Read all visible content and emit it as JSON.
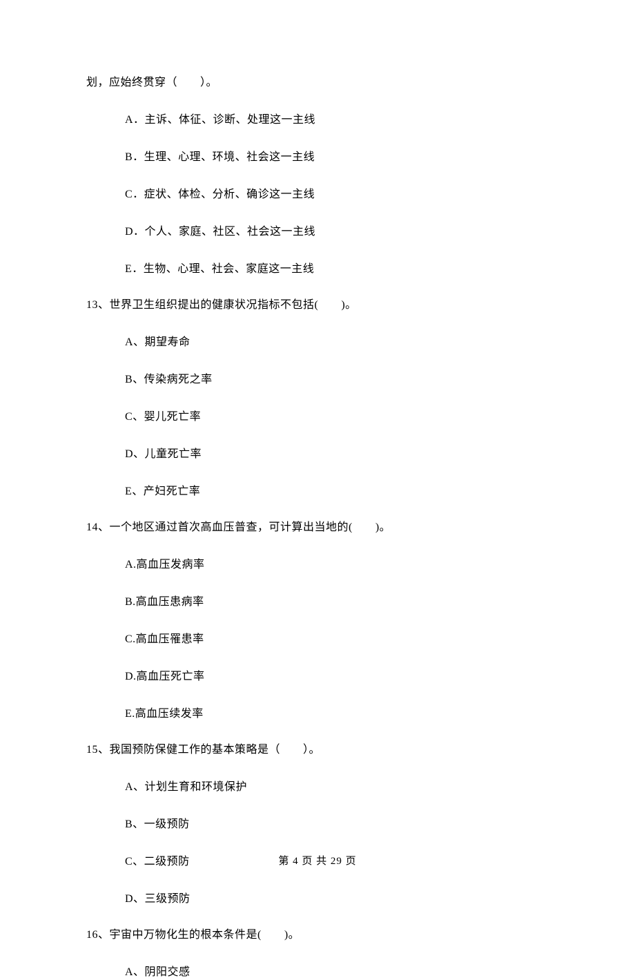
{
  "continuation": "划，应始终贯穿（　　）。",
  "q12": {
    "A": "A．主诉、体征、诊断、处理这一主线",
    "B": "B．生理、心理、环境、社会这一主线",
    "C": "C．症状、体检、分析、确诊这一主线",
    "D": "D．个人、家庭、社区、社会这一主线",
    "E": "E．生物、心理、社会、家庭这一主线"
  },
  "q13": {
    "stem": "13、世界卫生组织提出的健康状况指标不包括(　　)。",
    "A": "A、期望寿命",
    "B": "B、传染病死之率",
    "C": "C、婴儿死亡率",
    "D": "D、儿童死亡率",
    "E": "E、产妇死亡率"
  },
  "q14": {
    "stem": "14、一个地区通过首次高血压普查，可计算出当地的(　　)。",
    "A": "A.高血压发病率",
    "B": "B.高血压患病率",
    "C": "C.高血压罹患率",
    "D": "D.高血压死亡率",
    "E": "E.高血压续发率"
  },
  "q15": {
    "stem": "15、我国预防保健工作的基本策略是（　　）。",
    "A": "A、计划生育和环境保护",
    "B": "B、一级预防",
    "C": "C、二级预防",
    "D": "D、三级预防"
  },
  "q16": {
    "stem": "16、宇宙中万物化生的根本条件是(　　)。",
    "A": "A、阴阳交感"
  },
  "footer": "第 4 页 共 29 页"
}
